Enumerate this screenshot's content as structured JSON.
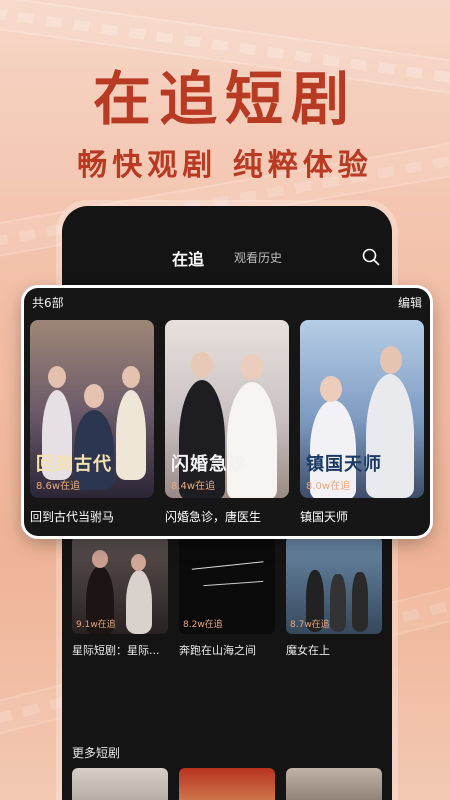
{
  "hero": {
    "title": "在追短剧",
    "subtitle": "畅快观剧 纯粹体验"
  },
  "app": {
    "tabs": [
      {
        "label": "在追",
        "active": true
      },
      {
        "label": "观看历史",
        "active": false
      }
    ],
    "search_icon": "search-icon",
    "following": {
      "count_label": "共6部",
      "edit_label": "编辑",
      "items": [
        {
          "title": "回到古代当驸马",
          "heat": "8.6w在追",
          "poster_text": "回到古代"
        },
        {
          "title": "闪婚急诊，唐医生",
          "heat": "8.4w在追",
          "poster_text": "闪婚急诊"
        },
        {
          "title": "镇国天师",
          "heat": "8.0w在追",
          "poster_text": "镇国天师"
        }
      ],
      "more_items": [
        {
          "title": "星际短剧：星际...",
          "heat": "9.1w在追"
        },
        {
          "title": "奔跑在山海之间",
          "heat": "8.2w在追"
        },
        {
          "title": "魔女在上",
          "heat": "8.7w在追"
        }
      ]
    },
    "more_section_label": "更多短剧",
    "colors": {
      "accent": "#b83a22",
      "heat": "#e9a980",
      "panel_bg": "#161616"
    }
  }
}
